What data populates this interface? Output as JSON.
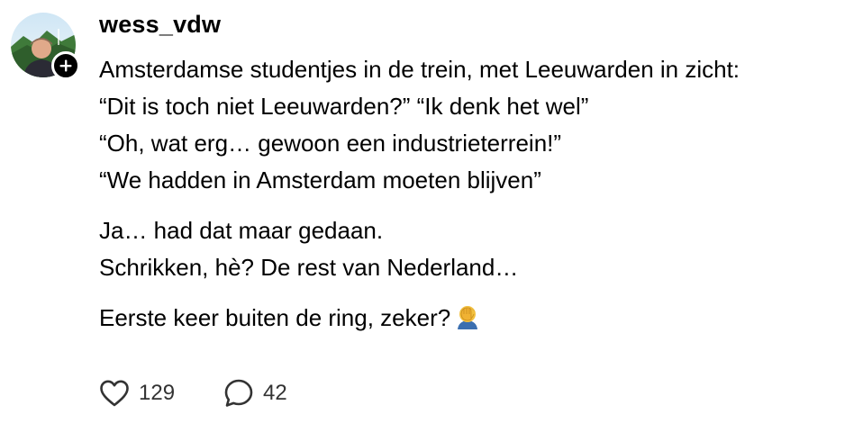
{
  "post": {
    "username": "wess_vdw",
    "paragraphs": [
      [
        "Amsterdamse studentjes in de trein, met Leeuwarden in zicht:",
        "“Dit is toch niet Leeuwarden?” “Ik denk het wel”",
        "“Oh, wat erg… gewoon een industrieterrein!”",
        "“We hadden in Amsterdam moeten blijven”"
      ],
      [
        "Ja… had dat maar gedaan.",
        "Schrikken, hè? De rest van Nederland…"
      ],
      [
        "Eerste keer buiten de ring, zeker?"
      ]
    ],
    "emoji": "facepalm-emoji",
    "likes": "129",
    "replies": "42"
  },
  "icons": {
    "follow": "plus-icon",
    "like": "heart-icon",
    "reply": "speech-bubble-icon"
  },
  "colors": {
    "text": "#000000",
    "muted": "#333333",
    "badge": "#000000"
  }
}
